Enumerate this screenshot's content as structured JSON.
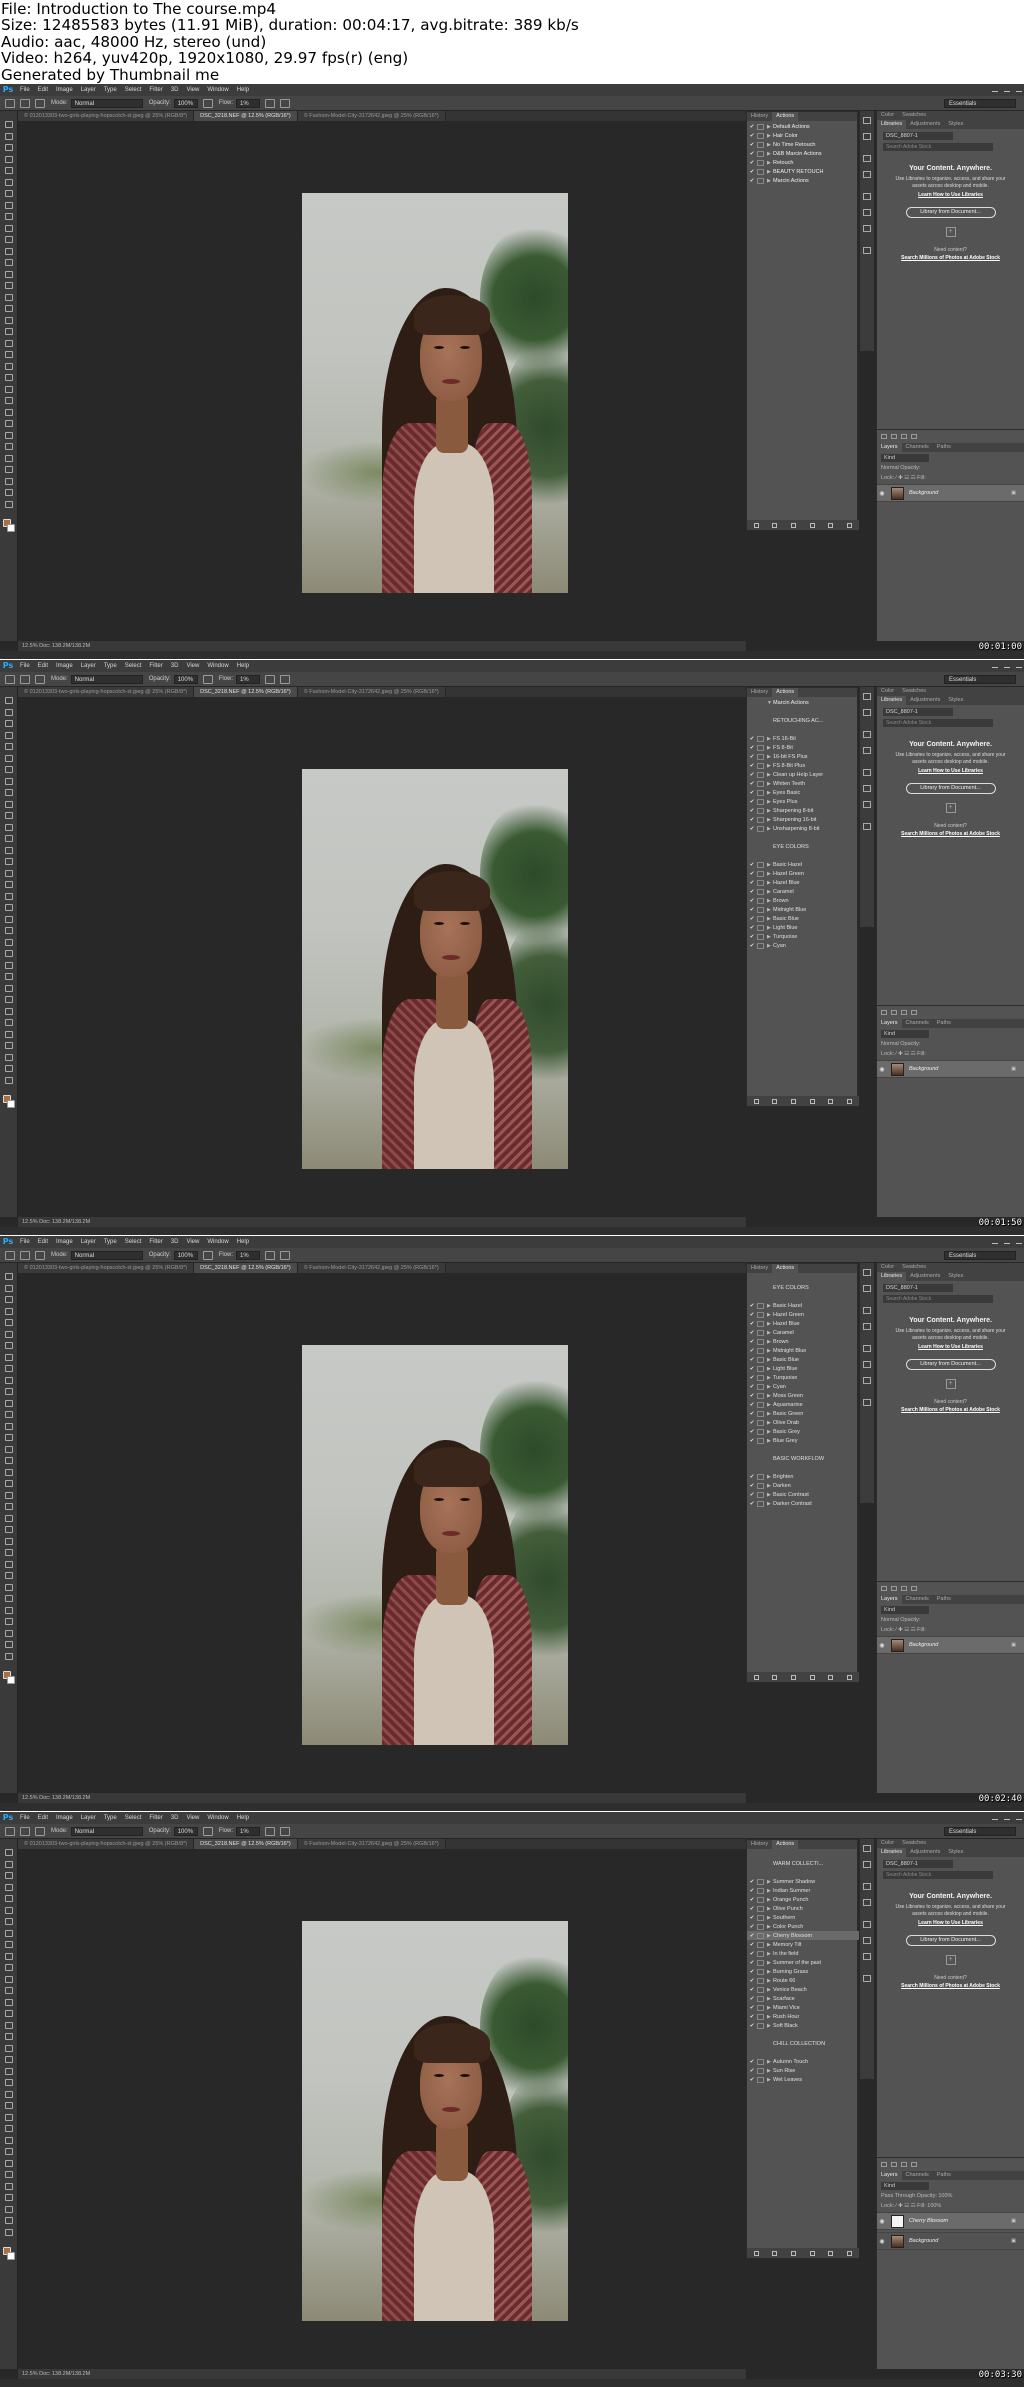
{
  "header": {
    "lines": [
      "File: Introduction to The course.mp4",
      "Size: 12485583 bytes (11.91 MiB), duration: 00:04:17, avg.bitrate: 389 kb/s",
      "Audio: aac, 48000 Hz, stereo (und)",
      "Video: h264, yuv420p, 1920x1080, 29.97 fps(r) (eng)",
      "Generated by Thumbnail me"
    ]
  },
  "app": {
    "logo": "Ps",
    "menu": [
      "File",
      "Edit",
      "Image",
      "Layer",
      "Type",
      "Select",
      "Filter",
      "3D",
      "View",
      "Window",
      "Help"
    ],
    "options": {
      "mode_label": "Mode:",
      "mode_value": "Normal",
      "opacity_label": "Opacity:",
      "opacity_value": "100%",
      "flow_label": "Flow:",
      "flow_value": "1%"
    },
    "workspace": "Essentials",
    "doc_tabs": [
      "© 012013303-two-girls-playing-hopscotch-st.jpeg @ 25% (RGB/8*)",
      "DSC_3218.NEF @ 12.5% (RGB/16*)",
      "© Fashion-Model-City-3172642.jpeg @ 25% (RGB/16*)"
    ],
    "status": "12.5%   Doc: 138.2M/138.2M",
    "panel_tabs": {
      "history": "History",
      "actions": "Actions"
    },
    "right_tabs": {
      "color": "Color",
      "swatches": "Swatches",
      "libraries": "Libraries",
      "adjustments": "Adjustments",
      "styles": "Styles"
    },
    "library_select": "DSC_8807-1",
    "library_search": "Search Adobe Stock",
    "cc": {
      "title": "Your Content. Anywhere.",
      "text": "Use Libraries to organize, access, and share your assets across desktop and mobile.",
      "link": "Learn How to Use Libraries",
      "button": "Library from Document...",
      "need": "Need content?",
      "stock": "Search Millions of Photos at Adobe Stock"
    },
    "layers_tabs": {
      "layers": "Layers",
      "channels": "Channels",
      "paths": "Paths"
    },
    "layer_kind": "Kind",
    "layer_opts": "Normal                Opacity:",
    "layer_opts_4": "Pass Through        Opacity: 100%",
    "layer_fill": "Lock:  ⁄ ✚ ☳ ☶          Fill:",
    "layer_fill_4": "Lock:  ⁄ ✚ ☳ ☶          Fill: 100%",
    "background_layer": "Background",
    "cherry_layer": "Cherry Blossom"
  },
  "frames": [
    {
      "timestamp": "00:01:00",
      "actions": [
        {
          "c": "✔",
          "t": "▶",
          "n": "Default Actions",
          "f": true
        },
        {
          "c": "✔",
          "t": "▶",
          "n": "Hair Color",
          "f": true
        },
        {
          "c": "✔",
          "t": "▶",
          "n": "No Time Retouch",
          "f": true
        },
        {
          "c": "✔",
          "t": "▶",
          "n": "D&B Marcin Actions",
          "f": true
        },
        {
          "c": "✔",
          "t": "▶",
          "n": "Retouch",
          "f": true
        },
        {
          "c": "✔",
          "t": "▶",
          "n": "BEAUTY RETOUCH",
          "f": true
        },
        {
          "c": "✔",
          "t": "▶",
          "n": "Marcin Actions",
          "f": true
        }
      ]
    },
    {
      "timestamp": "00:01:50",
      "actions": [
        {
          "c": "",
          "t": "▼",
          "n": "Marcin Actions",
          "f": true
        },
        {
          "c": "",
          "t": "",
          "n": "",
          "f": false
        },
        {
          "c": "",
          "t": "",
          "n": "RETOUCHING AC...",
          "f": false
        },
        {
          "c": "",
          "t": "",
          "n": "",
          "f": false
        },
        {
          "c": "✔",
          "t": "▶",
          "n": "FS 16-Bit",
          "f": false
        },
        {
          "c": "✔",
          "t": "▶",
          "n": "FS 8-Bit",
          "f": false
        },
        {
          "c": "✔",
          "t": "▶",
          "n": "16-bit FS Plus",
          "f": false
        },
        {
          "c": "✔",
          "t": "▶",
          "n": "FS 8-Bit Plus",
          "f": false
        },
        {
          "c": "✔",
          "t": "▶",
          "n": "Clean up Help Layer",
          "f": false
        },
        {
          "c": "✔",
          "t": "▶",
          "n": "Whiten Teeth",
          "f": false
        },
        {
          "c": "✔",
          "t": "▶",
          "n": "Eyes Basic",
          "f": false
        },
        {
          "c": "✔",
          "t": "▶",
          "n": "Eyes Plus",
          "f": false
        },
        {
          "c": "✔",
          "t": "▶",
          "n": "Sharpening 8-bit",
          "f": false
        },
        {
          "c": "✔",
          "t": "▶",
          "n": "Sharpening 16-bit",
          "f": false
        },
        {
          "c": "✔",
          "t": "▶",
          "n": "Unsharpening 8-bit",
          "f": false
        },
        {
          "c": "",
          "t": "",
          "n": "",
          "f": false
        },
        {
          "c": "",
          "t": "",
          "n": "EYE COLORS",
          "f": false
        },
        {
          "c": "",
          "t": "",
          "n": "",
          "f": false
        },
        {
          "c": "✔",
          "t": "▶",
          "n": "Basic Hazel",
          "f": false
        },
        {
          "c": "✔",
          "t": "▶",
          "n": "Hazel Green",
          "f": false
        },
        {
          "c": "✔",
          "t": "▶",
          "n": "Hazel Blue",
          "f": false
        },
        {
          "c": "✔",
          "t": "▶",
          "n": "Caramel",
          "f": false
        },
        {
          "c": "✔",
          "t": "▶",
          "n": "Brown",
          "f": false
        },
        {
          "c": "✔",
          "t": "▶",
          "n": "Midnight Blue",
          "f": false
        },
        {
          "c": "✔",
          "t": "▶",
          "n": "Basic Blue",
          "f": false
        },
        {
          "c": "✔",
          "t": "▶",
          "n": "Light Blue",
          "f": false
        },
        {
          "c": "✔",
          "t": "▶",
          "n": "Turquoise",
          "f": false
        },
        {
          "c": "✔",
          "t": "▶",
          "n": "Cyan",
          "f": false
        }
      ]
    },
    {
      "timestamp": "00:02:40",
      "actions": [
        {
          "c": "",
          "t": "",
          "n": "",
          "f": false
        },
        {
          "c": "",
          "t": "",
          "n": "EYE COLORS",
          "f": false
        },
        {
          "c": "",
          "t": "",
          "n": "",
          "f": false
        },
        {
          "c": "✔",
          "t": "▶",
          "n": "Basic Hazel",
          "f": false
        },
        {
          "c": "✔",
          "t": "▶",
          "n": "Hazel Green",
          "f": false
        },
        {
          "c": "✔",
          "t": "▶",
          "n": "Hazel Blue",
          "f": false
        },
        {
          "c": "✔",
          "t": "▶",
          "n": "Caramel",
          "f": false
        },
        {
          "c": "✔",
          "t": "▶",
          "n": "Brown",
          "f": false
        },
        {
          "c": "✔",
          "t": "▶",
          "n": "Midnight Blue",
          "f": false
        },
        {
          "c": "✔",
          "t": "▶",
          "n": "Basic Blue",
          "f": false
        },
        {
          "c": "✔",
          "t": "▶",
          "n": "Light Blue",
          "f": false
        },
        {
          "c": "✔",
          "t": "▶",
          "n": "Turquoise",
          "f": false
        },
        {
          "c": "✔",
          "t": "▶",
          "n": "Cyan",
          "f": false
        },
        {
          "c": "✔",
          "t": "▶",
          "n": "Moss Green",
          "f": false
        },
        {
          "c": "✔",
          "t": "▶",
          "n": "Aquamarine",
          "f": false
        },
        {
          "c": "✔",
          "t": "▶",
          "n": "Basic Green",
          "f": false
        },
        {
          "c": "✔",
          "t": "▶",
          "n": "Olive Drab",
          "f": false
        },
        {
          "c": "✔",
          "t": "▶",
          "n": "Basic Grey",
          "f": false
        },
        {
          "c": "✔",
          "t": "▶",
          "n": "Blue Grey",
          "f": false
        },
        {
          "c": "",
          "t": "",
          "n": "",
          "f": false
        },
        {
          "c": "",
          "t": "",
          "n": "BASIC WORKFLOW",
          "f": false
        },
        {
          "c": "",
          "t": "",
          "n": "",
          "f": false
        },
        {
          "c": "✔",
          "t": "▶",
          "n": "Brighten",
          "f": false
        },
        {
          "c": "✔",
          "t": "▶",
          "n": "Darken",
          "f": false
        },
        {
          "c": "✔",
          "t": "▶",
          "n": "Basic Contrast",
          "f": false
        },
        {
          "c": "✔",
          "t": "▶",
          "n": "Darker Contrast",
          "f": false
        }
      ]
    },
    {
      "timestamp": "00:03:30",
      "actions": [
        {
          "c": "",
          "t": "",
          "n": "",
          "f": false
        },
        {
          "c": "",
          "t": "",
          "n": "WARM COLLECTI...",
          "f": false
        },
        {
          "c": "",
          "t": "",
          "n": "",
          "f": false
        },
        {
          "c": "✔",
          "t": "▶",
          "n": "Summer Shadow",
          "f": false
        },
        {
          "c": "✔",
          "t": "▶",
          "n": "Indian Summer",
          "f": false
        },
        {
          "c": "✔",
          "t": "▶",
          "n": "Orange Punch",
          "f": false
        },
        {
          "c": "✔",
          "t": "▶",
          "n": "Olive Punch",
          "f": false
        },
        {
          "c": "✔",
          "t": "▶",
          "n": "Southern",
          "f": false
        },
        {
          "c": "✔",
          "t": "▶",
          "n": "Color Punch",
          "f": false
        },
        {
          "c": "✔",
          "t": "▶",
          "n": "Cherry Blossom",
          "f": false,
          "s": true
        },
        {
          "c": "✔",
          "t": "▶",
          "n": "Memory Tilt",
          "f": false
        },
        {
          "c": "✔",
          "t": "▶",
          "n": "In the field",
          "f": false
        },
        {
          "c": "✔",
          "t": "▶",
          "n": "Summer of the past",
          "f": false
        },
        {
          "c": "✔",
          "t": "▶",
          "n": "Burning Grass",
          "f": false
        },
        {
          "c": "✔",
          "t": "▶",
          "n": "Route 66",
          "f": false
        },
        {
          "c": "✔",
          "t": "▶",
          "n": "Venice Beach",
          "f": false
        },
        {
          "c": "✔",
          "t": "▶",
          "n": "Scarface",
          "f": false
        },
        {
          "c": "✔",
          "t": "▶",
          "n": "Miami Vice",
          "f": false
        },
        {
          "c": "✔",
          "t": "▶",
          "n": "Rush Hour",
          "f": false
        },
        {
          "c": "✔",
          "t": "▶",
          "n": "Soft Black",
          "f": false
        },
        {
          "c": "",
          "t": "",
          "n": "",
          "f": false
        },
        {
          "c": "",
          "t": "",
          "n": "CHILL COLLECTION",
          "f": false
        },
        {
          "c": "",
          "t": "",
          "n": "",
          "f": false
        },
        {
          "c": "✔",
          "t": "▶",
          "n": "Autumn Touch",
          "f": false
        },
        {
          "c": "✔",
          "t": "▶",
          "n": "Sun Rise",
          "f": false
        },
        {
          "c": "✔",
          "t": "▶",
          "n": "Wet Leaves",
          "f": false
        }
      ]
    }
  ]
}
